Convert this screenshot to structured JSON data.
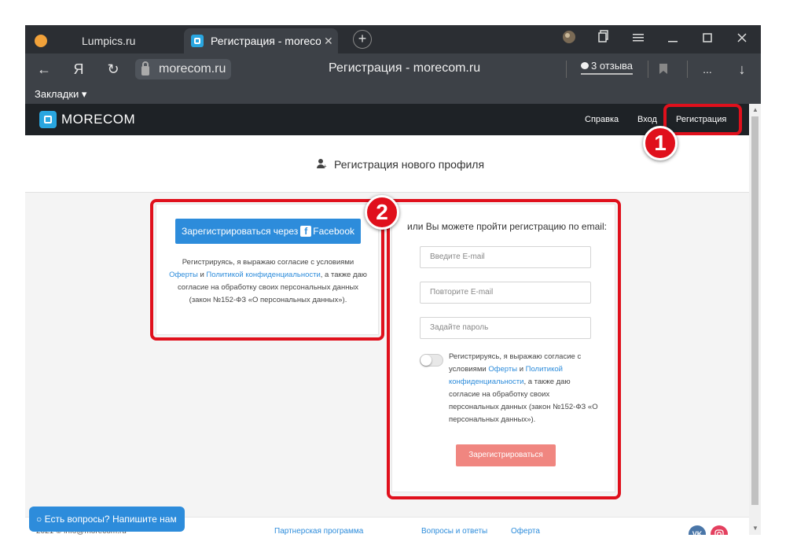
{
  "browser": {
    "tabs": [
      {
        "label": "Lumpics.ru"
      },
      {
        "label": "Регистрация - morecom",
        "close": "✕"
      }
    ],
    "new_tab": "+",
    "toolbar": {
      "back": "←",
      "ya": "Я",
      "reload": "↻",
      "domain": "morecom.ru",
      "page_title": "Регистрация - morecom.ru",
      "reviews": "3 отзыва",
      "more": "...",
      "download": "↓"
    },
    "bookmarks_label": "Закладки ▾"
  },
  "site": {
    "logo": "MORECOM",
    "nav": {
      "help": "Справка",
      "login": "Вход",
      "register": "Регистрация"
    },
    "subheader_title": "Регистрация нового профиля",
    "left": {
      "facebook_button": "Зарегистрироваться через",
      "facebook_icon": "f",
      "facebook_word": "Facebook",
      "text_part1": "Регистрируясь, я выражаю согласие с условиями",
      "offer_link": "Оферты",
      "and": "и",
      "privacy_link": "Политикой конфиденциальности",
      "text_part2": ", а также даю согласие на обработку своих персональных данных (закон №152-ФЗ «О персональных данных»)."
    },
    "right": {
      "title": "или Вы можете пройти регистрацию по email:",
      "email_placeholder": "Введите E-mail",
      "email_repeat_placeholder": "Повторите E-mail",
      "password_placeholder": "Задайте пароль",
      "consent_part1": "Регистрируясь, я выражаю согласие с условиями",
      "offer_link": "Оферты",
      "and": "и",
      "privacy_link": "Политикой конфиденциальности",
      "consent_part2": ", а также даю согласие на обработку своих персональных данных (закон №152-ФЗ «О персональных данных»).",
      "register_button": "Зарегистрироваться"
    },
    "footer": {
      "copyright": "2021 © info@morecom.ru",
      "partner": "Партнерская программа",
      "faq": "Вопросы и ответы",
      "offer": "Оферта",
      "vk": "VK"
    },
    "chat_button": "Есть вопросы? Напишите нам"
  },
  "annotations": {
    "badge1": "1",
    "badge2": "2"
  },
  "colors": {
    "accent": "#2d8cdb",
    "annotation": "#e0101c",
    "register_button": "#f08680",
    "header": "#1e2226"
  }
}
